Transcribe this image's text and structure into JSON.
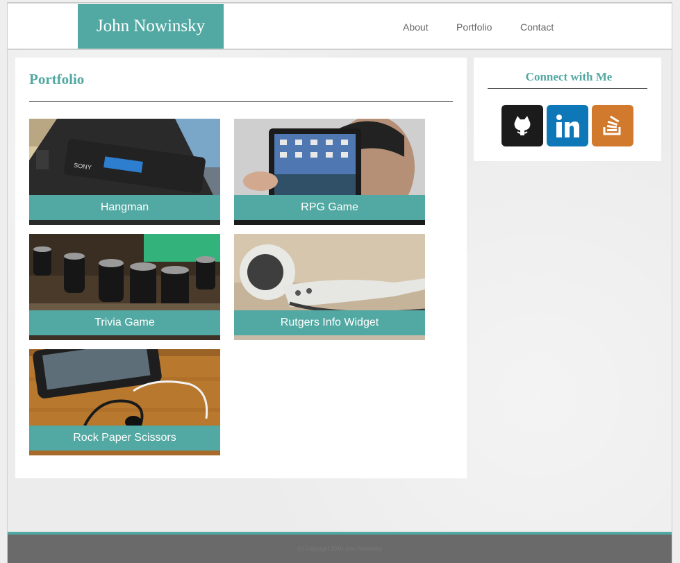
{
  "header": {
    "brand": "John Nowinsky",
    "nav": [
      {
        "label": "About"
      },
      {
        "label": "Portfolio"
      },
      {
        "label": "Contact"
      }
    ]
  },
  "main": {
    "title": "Portfolio",
    "projects": [
      {
        "label": "Hangman",
        "image": "walkman-player-photo"
      },
      {
        "label": "RPG Game",
        "image": "ipad-held-photo"
      },
      {
        "label": "Trivia Game",
        "image": "circuit-board-photo"
      },
      {
        "label": "Rutgers Info Widget",
        "image": "earbuds-photo"
      },
      {
        "label": "Rock Paper Scissors",
        "image": "phone-headphones-photo"
      }
    ]
  },
  "sidebar": {
    "title": "Connect with Me",
    "social": [
      {
        "icon": "github-icon",
        "color": "#1b1b1b"
      },
      {
        "icon": "linkedin-icon",
        "color": "#0e77b7"
      },
      {
        "icon": "stackoverflow-icon",
        "color": "#d1792c"
      }
    ]
  },
  "footer": {
    "text": "(c) Copyright 2016 John Nowinsky"
  },
  "colors": {
    "accent": "#52a8a2",
    "footer": "#6a6a6a",
    "background": "#ececec"
  }
}
